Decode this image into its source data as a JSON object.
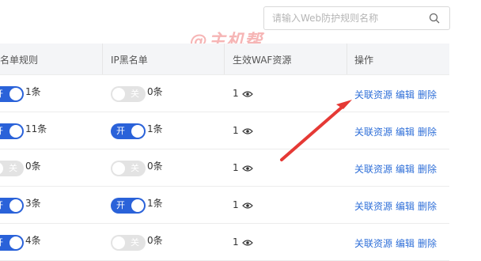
{
  "search": {
    "placeholder": "请输入Web防护规则名称",
    "icon": "search-icon"
  },
  "watermark": "@主机帮",
  "table": {
    "headers": [
      "名单规则",
      "IP黑名单",
      "生效WAF资源",
      "操作"
    ],
    "rows": [
      {
        "col1_toggle_on": true,
        "col1_toggle_label": "开",
        "col1_count": "1条",
        "ip_toggle_on": false,
        "ip_toggle_label": "关",
        "ip_count": "0条",
        "waf": "1",
        "actions": [
          "关联资源",
          "编辑",
          "删除"
        ]
      },
      {
        "col1_toggle_on": true,
        "col1_toggle_label": "开",
        "col1_count": "11条",
        "ip_toggle_on": true,
        "ip_toggle_label": "开",
        "ip_count": "1条",
        "waf": "1",
        "actions": [
          "关联资源",
          "编辑",
          "删除"
        ]
      },
      {
        "col1_toggle_on": false,
        "col1_toggle_label": "关",
        "col1_count": "0条",
        "ip_toggle_on": false,
        "ip_toggle_label": "关",
        "ip_count": "0条",
        "waf": "1",
        "actions": [
          "关联资源",
          "编辑",
          "删除"
        ]
      },
      {
        "col1_toggle_on": true,
        "col1_toggle_label": "开",
        "col1_count": "3条",
        "ip_toggle_on": true,
        "ip_toggle_label": "开",
        "ip_count": "1条",
        "waf": "1",
        "actions": [
          "关联资源",
          "编辑",
          "删除"
        ]
      },
      {
        "col1_toggle_on": true,
        "col1_toggle_label": "开",
        "col1_count": "4条",
        "ip_toggle_on": false,
        "ip_toggle_label": "关",
        "ip_count": "0条",
        "waf": "1",
        "actions": [
          "关联资源",
          "编辑",
          "删除"
        ]
      }
    ]
  },
  "colors": {
    "accent": "#2a62d9",
    "link": "#2f6fd8",
    "arrow": "#e53935"
  }
}
